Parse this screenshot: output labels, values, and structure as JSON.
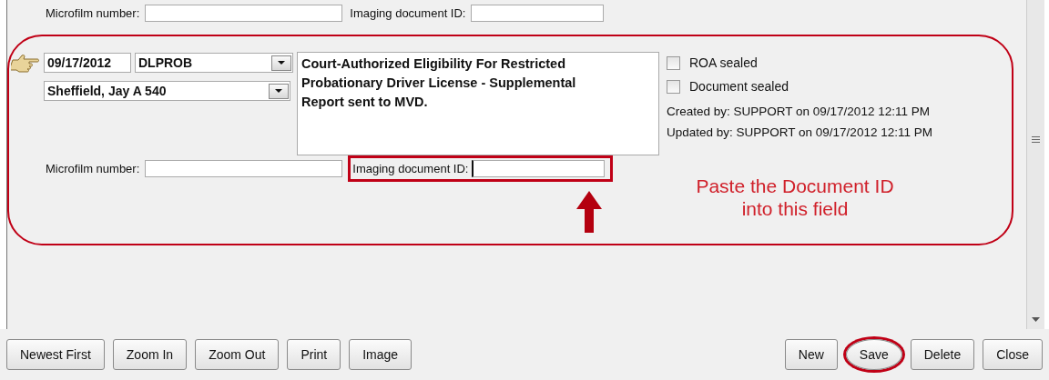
{
  "previous_record": {
    "microfilm_label": "Microfilm number:",
    "imaging_label": "Imaging document ID:"
  },
  "record": {
    "current": true,
    "date": "09/17/2012",
    "code": "DLPROB",
    "judge": "Sheffield, Jay A 540",
    "description": "Court-Authorized Eligibility For Restricted Probationary Driver License - Supplemental Report sent to MVD.",
    "checkboxes": [
      {
        "label": "ROA sealed",
        "checked": false
      },
      {
        "label": "Document sealed",
        "checked": false
      }
    ],
    "created": "Created by: SUPPORT on 09/17/2012 12:11 PM",
    "updated": "Updated by: SUPPORT on 09/17/2012 12:11 PM",
    "microfilm_label": "Microfilm number:",
    "imaging_label": "Imaging document ID:",
    "imaging_highlighted": true
  },
  "annotation": {
    "callout": "Paste the Document ID into this field"
  },
  "toolbar": {
    "left": [
      {
        "label": "Newest First",
        "circled": false
      },
      {
        "label": "Zoom In",
        "circled": false
      },
      {
        "label": "Zoom Out",
        "circled": false
      },
      {
        "label": "Print",
        "circled": false
      },
      {
        "label": "Image",
        "circled": false
      }
    ],
    "right": [
      {
        "label": "New",
        "circled": false
      },
      {
        "label": "Save",
        "circled": true
      },
      {
        "label": "Delete",
        "circled": false
      },
      {
        "label": "Close",
        "circled": false
      }
    ]
  }
}
